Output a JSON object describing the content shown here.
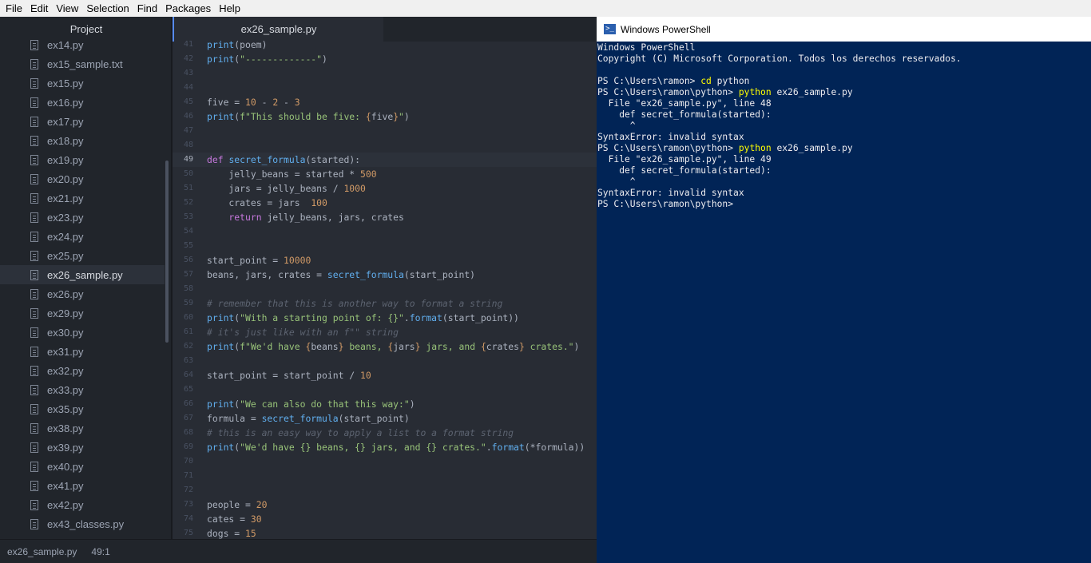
{
  "menu": [
    "File",
    "Edit",
    "View",
    "Selection",
    "Find",
    "Packages",
    "Help"
  ],
  "sidebar": {
    "title": "Project",
    "files": [
      {
        "name": "ex14.py"
      },
      {
        "name": "ex15_sample.txt"
      },
      {
        "name": "ex15.py"
      },
      {
        "name": "ex16.py"
      },
      {
        "name": "ex17.py"
      },
      {
        "name": "ex18.py"
      },
      {
        "name": "ex19.py"
      },
      {
        "name": "ex20.py"
      },
      {
        "name": "ex21.py"
      },
      {
        "name": "ex23.py"
      },
      {
        "name": "ex24.py"
      },
      {
        "name": "ex25.py"
      },
      {
        "name": "ex26_sample.py",
        "selected": true
      },
      {
        "name": "ex26.py"
      },
      {
        "name": "ex29.py"
      },
      {
        "name": "ex30.py"
      },
      {
        "name": "ex31.py"
      },
      {
        "name": "ex32.py"
      },
      {
        "name": "ex33.py"
      },
      {
        "name": "ex35.py"
      },
      {
        "name": "ex38.py"
      },
      {
        "name": "ex39.py"
      },
      {
        "name": "ex40.py"
      },
      {
        "name": "ex41.py"
      },
      {
        "name": "ex42.py"
      },
      {
        "name": "ex43_classes.py"
      }
    ]
  },
  "editor": {
    "tab_title": "ex26_sample.py",
    "current_line": 49,
    "lines": [
      {
        "n": 41,
        "t": [
          [
            "fn",
            "print"
          ],
          [
            "",
            "(poem)"
          ]
        ]
      },
      {
        "n": 42,
        "t": [
          [
            "fn",
            "print"
          ],
          [
            "",
            "("
          ],
          [
            "st",
            "\"-------------\""
          ],
          [
            "",
            ")"
          ]
        ]
      },
      {
        "n": 43,
        "t": []
      },
      {
        "n": 44,
        "t": []
      },
      {
        "n": 45,
        "t": [
          [
            "",
            "five = "
          ],
          [
            "nu",
            "10"
          ],
          [
            "",
            " - "
          ],
          [
            "nu",
            "2"
          ],
          [
            "",
            " - "
          ],
          [
            "nu",
            "3"
          ]
        ]
      },
      {
        "n": 46,
        "t": [
          [
            "fn",
            "print"
          ],
          [
            "",
            "("
          ],
          [
            "st",
            "f\"This should be five: "
          ],
          [
            "nu",
            "{"
          ],
          [
            "",
            "five"
          ],
          [
            "nu",
            "}"
          ],
          [
            "st",
            "\""
          ],
          [
            "",
            ")"
          ]
        ]
      },
      {
        "n": 47,
        "t": []
      },
      {
        "n": 48,
        "t": []
      },
      {
        "n": 49,
        "t": [
          [
            "kw",
            "def "
          ],
          [
            "fn",
            "secret_formula"
          ],
          [
            "",
            "(started):"
          ]
        ]
      },
      {
        "n": 50,
        "t": [
          [
            "",
            "    jelly_beans = started * "
          ],
          [
            "nu",
            "500"
          ]
        ]
      },
      {
        "n": 51,
        "t": [
          [
            "",
            "    jars = jelly_beans / "
          ],
          [
            "nu",
            "1000"
          ]
        ]
      },
      {
        "n": 52,
        "t": [
          [
            "",
            "    crates = jars  "
          ],
          [
            "nu",
            "100"
          ]
        ]
      },
      {
        "n": 53,
        "t": [
          [
            "kw",
            "    return "
          ],
          [
            "",
            "jelly_beans, jars, crates"
          ]
        ]
      },
      {
        "n": 54,
        "t": []
      },
      {
        "n": 55,
        "t": []
      },
      {
        "n": 56,
        "t": [
          [
            "",
            "start_point = "
          ],
          [
            "nu",
            "10000"
          ]
        ]
      },
      {
        "n": 57,
        "t": [
          [
            "",
            "beans, jars, crates = "
          ],
          [
            "fn",
            "secret_formula"
          ],
          [
            "",
            "(start_point)"
          ]
        ]
      },
      {
        "n": 58,
        "t": []
      },
      {
        "n": 59,
        "t": [
          [
            "cm",
            "# remember that this is another way to format a string"
          ]
        ]
      },
      {
        "n": 60,
        "t": [
          [
            "fn",
            "print"
          ],
          [
            "",
            "("
          ],
          [
            "st",
            "\"With a starting point of: {}\""
          ],
          [
            "",
            "."
          ],
          [
            "fn",
            "format"
          ],
          [
            "",
            "(start_point))"
          ]
        ]
      },
      {
        "n": 61,
        "t": [
          [
            "cm",
            "# it's just like with an f\"\" string"
          ]
        ]
      },
      {
        "n": 62,
        "t": [
          [
            "fn",
            "print"
          ],
          [
            "",
            "("
          ],
          [
            "st",
            "f\"We'd have "
          ],
          [
            "nu",
            "{"
          ],
          [
            "",
            "beans"
          ],
          [
            "nu",
            "}"
          ],
          [
            "st",
            " beans, "
          ],
          [
            "nu",
            "{"
          ],
          [
            "",
            "jars"
          ],
          [
            "nu",
            "}"
          ],
          [
            "st",
            " jars, and "
          ],
          [
            "nu",
            "{"
          ],
          [
            "",
            "crates"
          ],
          [
            "nu",
            "}"
          ],
          [
            "st",
            " crates.\""
          ],
          [
            "",
            ")"
          ]
        ]
      },
      {
        "n": 63,
        "t": []
      },
      {
        "n": 64,
        "t": [
          [
            "",
            "start_point = start_point / "
          ],
          [
            "nu",
            "10"
          ]
        ]
      },
      {
        "n": 65,
        "t": []
      },
      {
        "n": 66,
        "t": [
          [
            "fn",
            "print"
          ],
          [
            "",
            "("
          ],
          [
            "st",
            "\"We can also do that this way:\""
          ],
          [
            "",
            ")"
          ]
        ]
      },
      {
        "n": 67,
        "t": [
          [
            "",
            "formula = "
          ],
          [
            "fn",
            "secret_formula"
          ],
          [
            "",
            "(start_point)"
          ]
        ]
      },
      {
        "n": 68,
        "t": [
          [
            "cm",
            "# this is an easy way to apply a list to a format string"
          ]
        ]
      },
      {
        "n": 69,
        "t": [
          [
            "fn",
            "print"
          ],
          [
            "",
            "("
          ],
          [
            "st",
            "\"We'd have {} beans, {} jars, and {} crates.\""
          ],
          [
            "",
            "."
          ],
          [
            "fn",
            "format"
          ],
          [
            "",
            "(*formula))"
          ]
        ]
      },
      {
        "n": 70,
        "t": []
      },
      {
        "n": 71,
        "t": []
      },
      {
        "n": 72,
        "t": []
      },
      {
        "n": 73,
        "t": [
          [
            "",
            "people = "
          ],
          [
            "nu",
            "20"
          ]
        ]
      },
      {
        "n": 74,
        "t": [
          [
            "",
            "cates = "
          ],
          [
            "nu",
            "30"
          ]
        ]
      },
      {
        "n": 75,
        "t": [
          [
            "",
            "dogs = "
          ],
          [
            "nu",
            "15"
          ]
        ]
      }
    ]
  },
  "statusbar": {
    "file": "ex26_sample.py",
    "cursor": "49:1"
  },
  "powershell": {
    "title": "Windows PowerShell",
    "lines": [
      [
        [
          "",
          "Windows PowerShell"
        ]
      ],
      [
        [
          "",
          "Copyright (C) Microsoft Corporation. Todos los derechos reservados."
        ]
      ],
      [],
      [
        [
          "",
          "PS C:\\Users\\ramon> "
        ],
        [
          "cmd",
          "cd"
        ],
        [
          "",
          " python"
        ]
      ],
      [
        [
          "",
          "PS C:\\Users\\ramon\\python> "
        ],
        [
          "cmd",
          "python"
        ],
        [
          "",
          " ex26_sample.py"
        ]
      ],
      [
        [
          "",
          "  File \"ex26_sample.py\", line 48"
        ]
      ],
      [
        [
          "",
          "    def secret_formula(started):"
        ]
      ],
      [
        [
          "",
          "      ^"
        ]
      ],
      [
        [
          "",
          "SyntaxError: invalid syntax"
        ]
      ],
      [
        [
          "",
          "PS C:\\Users\\ramon\\python> "
        ],
        [
          "cmd",
          "python"
        ],
        [
          "",
          " ex26_sample.py"
        ]
      ],
      [
        [
          "",
          "  File \"ex26_sample.py\", line 49"
        ]
      ],
      [
        [
          "",
          "    def secret_formula(started):"
        ]
      ],
      [
        [
          "",
          "      ^"
        ]
      ],
      [
        [
          "",
          "SyntaxError: invalid syntax"
        ]
      ],
      [
        [
          "",
          "PS C:\\Users\\ramon\\python>"
        ]
      ]
    ]
  },
  "colors": {
    "accent": "#568af2",
    "ps_background": "#012456",
    "editor_background": "#282c34"
  }
}
